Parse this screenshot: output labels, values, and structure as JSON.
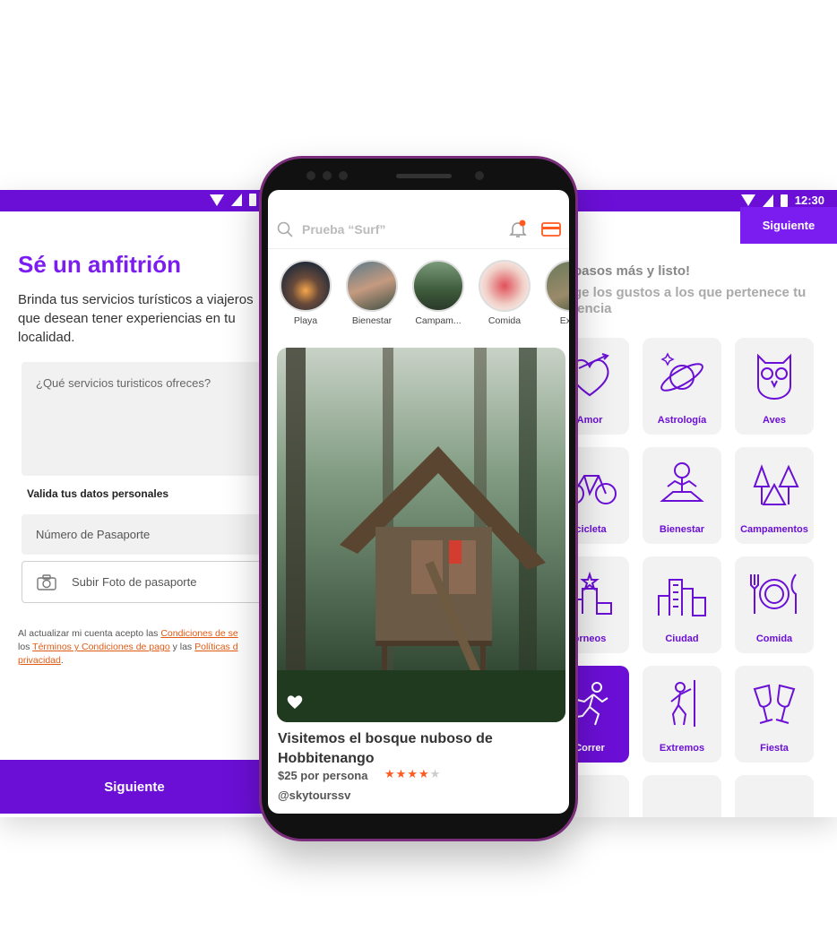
{
  "left": {
    "title": "Sé un anfitrión",
    "description": "Brinda tus servicios turísticos a viajeros que desean tener experiencias en tu localidad.",
    "services_placeholder": "¿Qué servicios turisticos ofreces?",
    "validate_label": "Valida tus datos personales",
    "passport_placeholder": "Número de Pasaporte",
    "upload_label": "Subir Foto de pasaporte",
    "terms_prefix": "Al actualizar mi cuenta acepto las ",
    "terms_link1": "Condiciones de se",
    "terms_mid1": " los ",
    "terms_link2": "Términos y Condiciones de pago",
    "terms_mid2": " y las ",
    "terms_link3": "Políticas d",
    "terms_link4": "privacidad",
    "terms_suffix": ".",
    "next_label": "Siguiente"
  },
  "status": {
    "time": "12:30"
  },
  "right": {
    "next_label": "Siguiente",
    "steps_text": "pasos más y listo!",
    "choose_text": "ge los gustos a los que pertenece tu iencia",
    "categories": [
      {
        "label": "Amor",
        "icon": "heart-icon"
      },
      {
        "label": "Astrología",
        "icon": "planet-icon"
      },
      {
        "label": "Aves",
        "icon": "owl-icon"
      },
      {
        "label": "icicleta",
        "icon": "bicycle-icon"
      },
      {
        "label": "Bienestar",
        "icon": "meditation-icon"
      },
      {
        "label": "Campamentos",
        "icon": "tent-icon"
      },
      {
        "label": "orneos",
        "icon": "podium-icon"
      },
      {
        "label": "Ciudad",
        "icon": "city-icon"
      },
      {
        "label": "Comida",
        "icon": "plate-icon"
      },
      {
        "label": "Correr",
        "icon": "runner-icon"
      },
      {
        "label": "Extremos",
        "icon": "climber-icon"
      },
      {
        "label": "Fiesta",
        "icon": "toast-icon"
      }
    ]
  },
  "phone": {
    "search_placeholder": "Prueba “Surf”",
    "stories": [
      {
        "label": "Playa"
      },
      {
        "label": "Bienestar"
      },
      {
        "label": "Campam..."
      },
      {
        "label": "Comida"
      },
      {
        "label": "Extre"
      }
    ],
    "post": {
      "title": "Visitemos el bosque nuboso de Hobbitenango",
      "price": "$25 por persona",
      "rating": 4,
      "rating_max": 5,
      "user": "@skytourssv"
    }
  },
  "colors": {
    "brand": "#6b0fd6",
    "accent": "#ff5a1f"
  }
}
